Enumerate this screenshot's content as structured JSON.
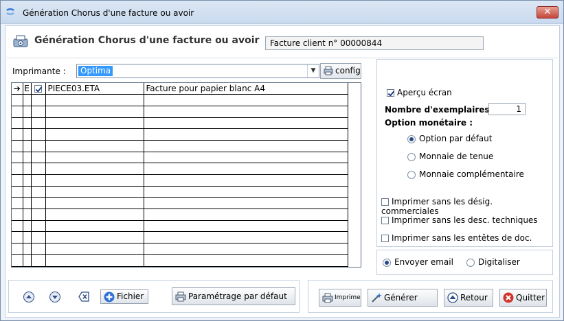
{
  "window": {
    "title": "Génération Chorus d'une facture ou avoir",
    "close_label": "✕"
  },
  "header": {
    "title": "Génération Chorus d'une facture ou avoir",
    "invoice_label": "Facture client n° 00000844"
  },
  "printer": {
    "label": "Imprimante :",
    "selected": "Optima",
    "config_label": "config"
  },
  "grid": {
    "header_marker": "➔",
    "header_e": "E",
    "rows": [
      {
        "checked": true,
        "file": "PIECE03.ETA",
        "description": "Facture pour papier blanc A4"
      }
    ],
    "empty_row_count": 15
  },
  "options": {
    "preview_label": "Aperçu écran",
    "preview_checked": true,
    "copies_label": "Nombre d'exemplaires :",
    "copies_value": "1",
    "currency_label": "Option monétaire :",
    "currency_options": [
      "Option par défaut",
      "Monnaie de tenue",
      "Monnaie complémentaire"
    ],
    "currency_selected": 0,
    "print_without_commercial": "Imprimer sans les désig. commerciales",
    "print_without_technical": "Imprimer sans les desc. techniques",
    "print_without_headers": "Imprimer sans les entêtes de doc."
  },
  "send": {
    "email_label": "Envoyer email",
    "digitize_label": "Digitaliser",
    "selected": "email"
  },
  "nav": {
    "file_label": "Fichier",
    "default_settings_label": "Paramétrage par défaut"
  },
  "actions": {
    "print_label": "Imprimer",
    "generate_label": "Générer",
    "back_label": "Retour",
    "quit_label": "Quitter"
  },
  "colors": {
    "selection": "#3399ff",
    "window_bg": "#eef3fa",
    "quit_red": "#d0342c",
    "accent_blue": "#2f4c88"
  }
}
